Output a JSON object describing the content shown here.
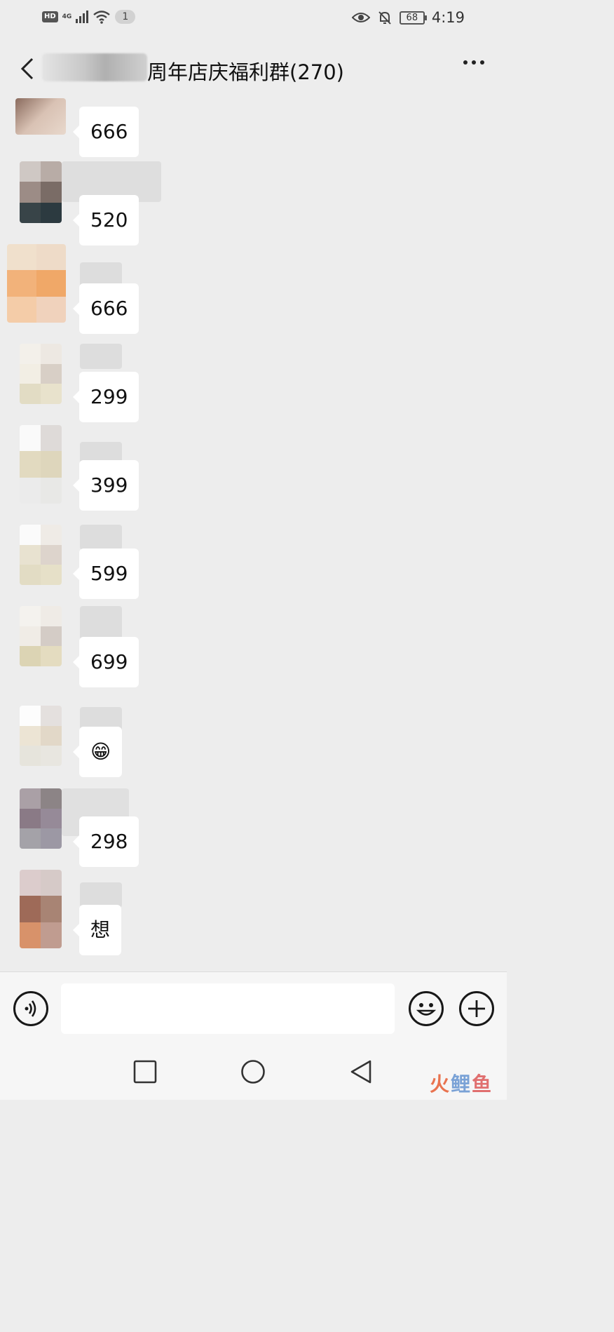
{
  "status_bar": {
    "hd": "HD",
    "network": "4G",
    "sim_count": "1",
    "battery": "68",
    "time": "4:19"
  },
  "header": {
    "title": "周年店庆福利群(270)",
    "back_icon": "chevron-left-icon",
    "more_icon": "more-horizontal-icon"
  },
  "messages": [
    {
      "text": "666"
    },
    {
      "text": "520"
    },
    {
      "text": "666"
    },
    {
      "text": "299"
    },
    {
      "text": "399"
    },
    {
      "text": "599"
    },
    {
      "text": "699"
    },
    {
      "text": "😁"
    },
    {
      "text": "298"
    },
    {
      "text": "想"
    }
  ],
  "input_bar": {
    "placeholder": "",
    "voice_icon": "voice-icon",
    "emoji_icon": "emoji-icon",
    "plus_icon": "plus-icon"
  },
  "system_nav": {
    "recents_icon": "square-icon",
    "home_icon": "circle-icon",
    "back_icon": "triangle-back-icon"
  },
  "watermark": {
    "c1": "火",
    "c2": "鲤",
    "c3": "鱼"
  }
}
